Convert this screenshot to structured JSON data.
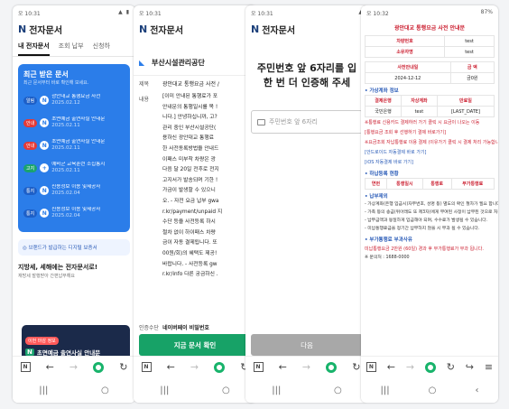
{
  "status_bar": {
    "p1_time": "오 10:31",
    "p2_time": "오 10:31",
    "p3_time": "오 10:31",
    "p4_time": "오 10:32",
    "p4_right": "87%"
  },
  "app": {
    "logo": "N",
    "title": "전자문서"
  },
  "p1": {
    "tabs": [
      "내 전자문서",
      "조회 납부",
      "신청하"
    ],
    "recent_title": "최근 받은 문서",
    "recent_subtitle": "최근 문서부터 바로 확인해 보세요.",
    "items": [
      {
        "badge": "알림",
        "icon": "N",
        "title": "광안대교 통행요금 사전",
        "date": "2025.02.12",
        "color": "#1d5fc7"
      },
      {
        "badge": "안내",
        "icon": "N",
        "title": "초면예금 출연사실 안내문",
        "date": "2025.02.11",
        "color": "#e53935"
      },
      {
        "badge": "안내",
        "icon": "N",
        "title": "초면예금 출연사실 안내문",
        "date": "2025.02.11",
        "color": "#e53935"
      },
      {
        "badge": "고지",
        "icon": "+",
        "title": "예비군 교육훈련 소집통지",
        "date": "2025.02.11",
        "color": "#1aa36e"
      },
      {
        "badge": "통지",
        "icon": "N",
        "title": "신용정보 이용 및제공사",
        "date": "2025.02.04",
        "color": "#1d5fc7"
      },
      {
        "badge": "통지",
        "icon": "N",
        "title": "신용정보 이용 및제공사",
        "date": "2025.02.04",
        "color": "#1d5fc7"
      }
    ],
    "banner": "브랜드가 발급하는 디지털 보증서",
    "promo_title": "지방세, 세해에는 전자문서로!",
    "promo_sub": "재방세 발행받아 간편납부해요",
    "notif_tag": "이번 마감 정보",
    "notif_text": "초면예금 출연사실 안내문"
  },
  "p2": {
    "org": "부산시설관리공단",
    "k_title": "제목",
    "v_title": "광안대교 통행요금 사전 /",
    "k_body": "내용",
    "body_lines": [
      "[이미 안내된 통행료가 포",
      "안내문의 통행일시를 목 !",
      "니다.] 안녕하십니까, 고?",
      "관리 중인 부산시설공단(",
      "용하신 광안대교 통행료",
      "한 사전동록방법을 안내드",
      "이패스 미부착 차량은 광",
      "다음 달 20일 전후로 전지",
      "고지서가 발송되며 기한 !",
      "가금이 발생할 수 있으니",
      "오. - 자전 요금 납부 gwa",
      "r.kr/payment/unpaid 지",
      "수단 등을 사전등록 하시",
      "절차 없이 하이패스 차량",
      "금이 자동 결제됩니다. 또",
      "00원/회)의 혜택도 제공!",
      "바랍니다. - 사전등록 gw",
      "r.kr/info 다른 궁금하신 ."
    ],
    "auth_k": "인증수단",
    "auth_v": "네이버페이 비밀번호",
    "button": "지금 문서 확인"
  },
  "p3": {
    "title_line1": "주민번호 앞 6자리를 입",
    "title_line2": "한 번 더 인증해 주세",
    "input_placeholder": "주민번호 앞 6자리",
    "button": "다음"
  },
  "p4": {
    "doc_title": "광안대교 통행요금 사전 안내문",
    "table1": [
      [
        "차량번호",
        "test"
      ],
      [
        "소유자명",
        "test"
      ]
    ],
    "table2_head": [
      "사전안내일",
      "금 액"
    ],
    "table2_row": [
      "2024-12-12",
      "금0원"
    ],
    "section1": "• 가상계좌 정보",
    "table3_head": [
      "결제은행",
      "자상계좌",
      "만료일"
    ],
    "table3_row": [
      "국민은행",
      "test",
      "[LAST_DATE]"
    ],
    "red1": "※통행료 신용카드 결제하러 가기 클릭 시 요금이 나오는 이동",
    "red2": "[통행요금 조회 후 선행하기 결제 바로가기]",
    "red3": "※요금조회 자납통행료 이용 결제 (이유가기 클릭 시 결제 처리 가능합니다.)",
    "link1": "[안드로이드 자동결제 바로 가기]",
    "link2": "[iOS 자동결제 바로 가기]",
    "section2": "• 하납등록 현황",
    "table4_head": [
      "연번",
      "통행일시",
      "통행로",
      "부가통행료"
    ],
    "section3": "• 납부제외",
    "notes": [
      "- 가상계좌(은행 입금시)자부번호, 성명 등) 별도의 확인 절차가 필요 합니다.",
      "- 가족 등의 송금(위아래도 또 제3자)에게 부여된 사정이 납부된 것으로 처리 됩니다.",
      "- 납부금액과 동일하게 입금해야 되며, 수수료가 발생될 수 있습니다.",
      "- 미납통행료금을 정기간 납부하지 않을 시 부과 될 수 있습니다."
    ],
    "section4": "• 부가통행료 부과사유",
    "red4": "미납통행요금 2만원 (60일) 경과 후 부가통행료가 부과 됩니다.",
    "footer": "※ 문의처 : 1688-0000"
  }
}
